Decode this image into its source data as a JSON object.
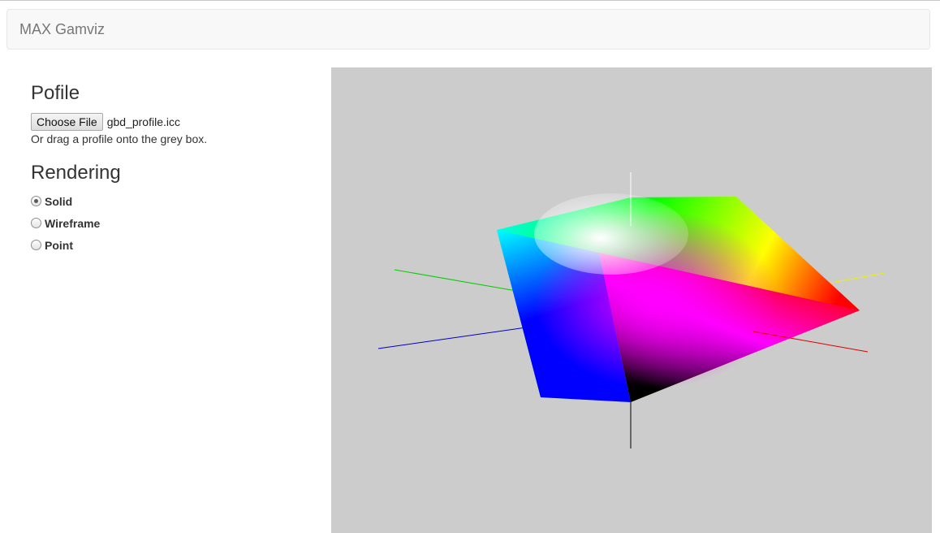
{
  "navbar": {
    "brand": "MAX Gamviz"
  },
  "profile": {
    "heading": "Pofile",
    "choose_label": "Choose File",
    "filename": "gbd_profile.icc",
    "hint": "Or drag a profile onto the grey box."
  },
  "rendering": {
    "heading": "Rendering",
    "options": [
      {
        "label": "Solid",
        "checked": true
      },
      {
        "label": "Wireframe",
        "checked": false
      },
      {
        "label": "Point",
        "checked": false
      }
    ]
  },
  "viewer": {
    "background": "#cccccc",
    "axis_colors": {
      "green": "#00cc00",
      "blue": "#0000cc",
      "red": "#dd0000",
      "yellow": "#eeee00",
      "white": "#ffffff",
      "black": "#000000"
    },
    "gamut_colors": {
      "white": "#ffffff",
      "cyan": "#00ffff",
      "green": "#00ff00",
      "yellow": "#ffff00",
      "red": "#ff0000",
      "magenta": "#ff00ff",
      "blue": "#0000ff",
      "black": "#000000"
    }
  }
}
